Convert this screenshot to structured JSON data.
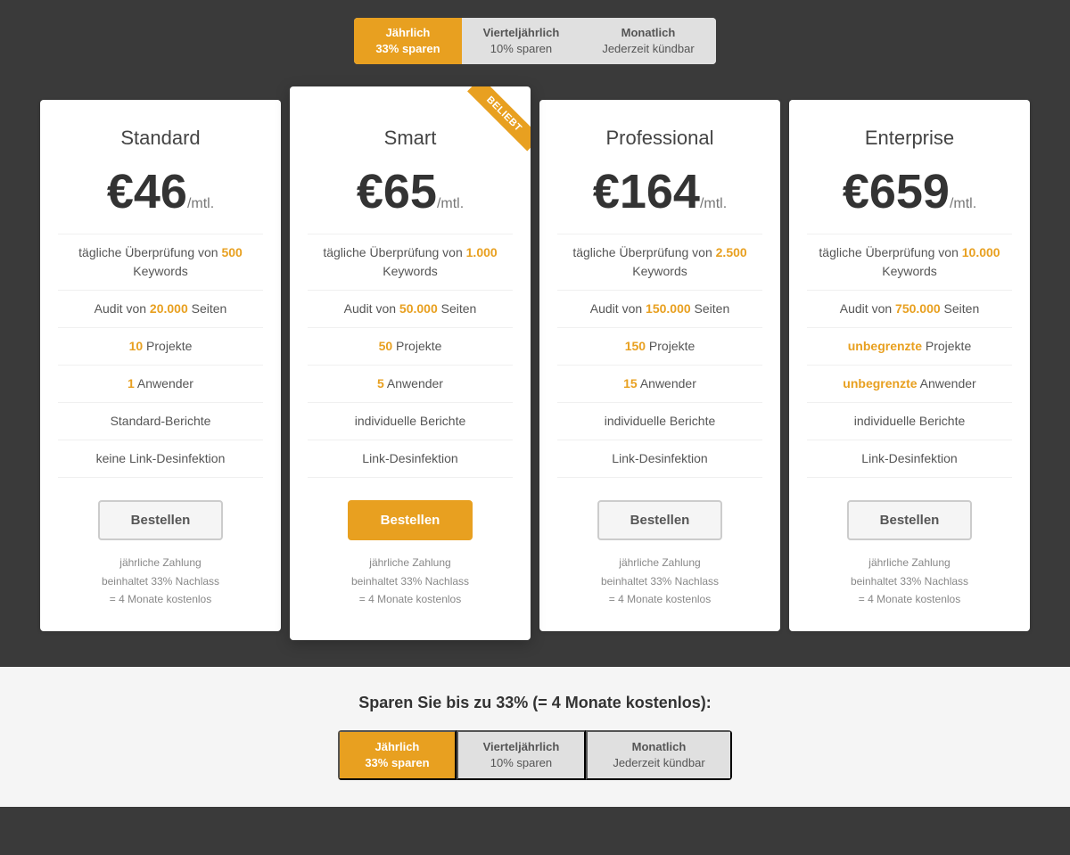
{
  "billing": {
    "options": [
      {
        "id": "yearly",
        "line1": "Jährlich",
        "line2": "33% sparen",
        "active": true
      },
      {
        "id": "quarterly",
        "line1": "Vierteljährlich",
        "line2": "10% sparen",
        "active": false
      },
      {
        "id": "monthly",
        "line1": "Monatlich",
        "line2": "Jederzeit kündbar",
        "active": false
      }
    ]
  },
  "plans": [
    {
      "id": "standard",
      "name": "Standard",
      "featured": false,
      "price": "€46",
      "unit": "/mtl.",
      "ribbon": null,
      "features": [
        {
          "text_plain": "tägliche Überprüfung von ",
          "highlight": "500",
          "text_after": " Keywords"
        },
        {
          "text_plain": "Audit von ",
          "highlight": "20.000",
          "text_after": " Seiten"
        },
        {
          "text_plain": "",
          "highlight": "10",
          "text_after": " Projekte"
        },
        {
          "text_plain": "",
          "highlight": "1",
          "text_after": " Anwender"
        },
        {
          "text_plain": "Standard-Berichte",
          "highlight": "",
          "text_after": ""
        },
        {
          "text_plain": "keine Link-Desinfektion",
          "highlight": "",
          "text_after": ""
        }
      ],
      "btn_label": "Bestellen",
      "btn_primary": false,
      "payment_note": "jährliche Zahlung\nbeinhaltet 33% Nachlass\n= 4 Monate kostenlos"
    },
    {
      "id": "smart",
      "name": "Smart",
      "featured": true,
      "price": "€65",
      "unit": "/mtl.",
      "ribbon": "BELIEBT",
      "features": [
        {
          "text_plain": "tägliche Überprüfung von ",
          "highlight": "1.000",
          "text_after": " Keywords"
        },
        {
          "text_plain": "Audit von ",
          "highlight": "50.000",
          "text_after": " Seiten"
        },
        {
          "text_plain": "",
          "highlight": "50",
          "text_after": " Projekte"
        },
        {
          "text_plain": "",
          "highlight": "5",
          "text_after": " Anwender"
        },
        {
          "text_plain": "individuelle Berichte",
          "highlight": "",
          "text_after": ""
        },
        {
          "text_plain": "Link-Desinfektion",
          "highlight": "",
          "text_after": ""
        }
      ],
      "btn_label": "Bestellen",
      "btn_primary": true,
      "payment_note": "jährliche Zahlung\nbeinhaltet 33% Nachlass\n= 4 Monate kostenlos"
    },
    {
      "id": "professional",
      "name": "Professional",
      "featured": false,
      "price": "€164",
      "unit": "/mtl.",
      "ribbon": null,
      "features": [
        {
          "text_plain": "tägliche Überprüfung von ",
          "highlight": "2.500",
          "text_after": " Keywords"
        },
        {
          "text_plain": "Audit von ",
          "highlight": "150.000",
          "text_after": " Seiten"
        },
        {
          "text_plain": "",
          "highlight": "150",
          "text_after": " Projekte"
        },
        {
          "text_plain": "",
          "highlight": "15",
          "text_after": " Anwender"
        },
        {
          "text_plain": "individuelle Berichte",
          "highlight": "",
          "text_after": ""
        },
        {
          "text_plain": "Link-Desinfektion",
          "highlight": "",
          "text_after": ""
        }
      ],
      "btn_label": "Bestellen",
      "btn_primary": false,
      "payment_note": "jährliche Zahlung\nbeinhaltet 33% Nachlass\n= 4 Monate kostenlos"
    },
    {
      "id": "enterprise",
      "name": "Enterprise",
      "featured": false,
      "price": "€659",
      "unit": "/mtl.",
      "ribbon": null,
      "features": [
        {
          "text_plain": "tägliche Überprüfung von ",
          "highlight": "10.000",
          "text_after": " Keywords"
        },
        {
          "text_plain": "Audit von ",
          "highlight": "750.000",
          "text_after": " Seiten"
        },
        {
          "text_plain": "",
          "highlight": "unbegrenzte",
          "text_after": " Projekte"
        },
        {
          "text_plain": "",
          "highlight": "unbegrenzte",
          "text_after": " Anwender"
        },
        {
          "text_plain": "individuelle Berichte",
          "highlight": "",
          "text_after": ""
        },
        {
          "text_plain": "Link-Desinfektion",
          "highlight": "",
          "text_after": ""
        }
      ],
      "btn_label": "Bestellen",
      "btn_primary": false,
      "payment_note": "jährliche Zahlung\nbeinhaltet 33% Nachlass\n= 4 Monate kostenlos"
    }
  ],
  "bottom": {
    "save_text": "Sparen Sie bis zu 33% (= 4 Monate kostenlos):",
    "options": [
      {
        "line1": "Jährlich",
        "line2": "33% sparen",
        "active": true
      },
      {
        "line1": "Vierteljährlich",
        "line2": "10% sparen",
        "active": false
      },
      {
        "line1": "Monatlich",
        "line2": "Jederzeit kündbar",
        "active": false
      }
    ]
  }
}
